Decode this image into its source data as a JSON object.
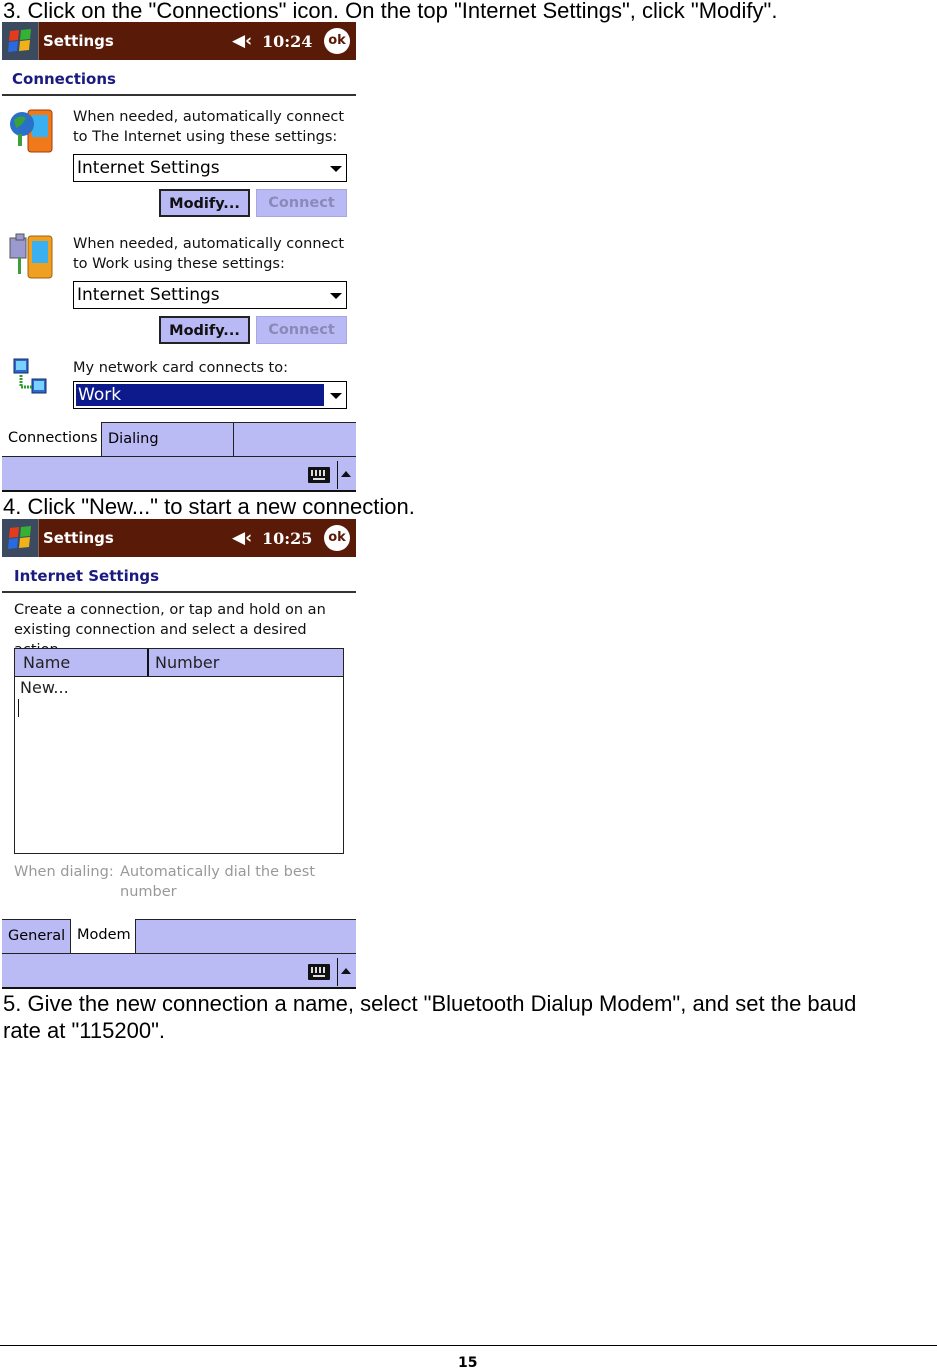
{
  "steps": {
    "step3": "3. Click on the \"Connections\" icon. On the top \"Internet Settings\", click \"Modify\".",
    "step4": "4. Click \"New...\" to start a new connection.",
    "step5_line1": "5. Give the new connection a name, select \"Bluetooth Dialup Modem\", and set the baud",
    "step5_line2": "rate at \"115200\"."
  },
  "colors": {
    "titlebar": "#5a1a08",
    "header_text": "#1a1a80",
    "tab_bg": "#babaf4",
    "selection": "#0c1a8c"
  },
  "screen1": {
    "titlebar": {
      "icon": "windows-start-icon",
      "title": "Settings",
      "volume_icon": "speaker-icon",
      "time": "10:24",
      "ok_label": "ok"
    },
    "header": "Connections",
    "internet": {
      "icon": "globe-pda-icon",
      "desc_line1": "When needed, automatically connect",
      "desc_line2": "to The Internet using these settings:",
      "dropdown_value": "Internet Settings",
      "modify_label": "Modify...",
      "connect_label": "Connect"
    },
    "work": {
      "icon": "building-pda-icon",
      "desc_line1": "When needed, automatically connect",
      "desc_line2": "to Work using these settings:",
      "dropdown_value": "Internet Settings",
      "modify_label": "Modify...",
      "connect_label": "Connect"
    },
    "network": {
      "icon": "network-computers-icon",
      "label": "My network card connects to:",
      "dropdown_value": "Work"
    },
    "tabs": [
      {
        "label": "Connections",
        "active": true
      },
      {
        "label": "Dialing Locations",
        "active": false
      }
    ],
    "menubar": {
      "keyboard_icon": "keyboard-icon",
      "arrow_icon": "up-arrow-icon"
    }
  },
  "screen2": {
    "titlebar": {
      "icon": "windows-start-icon",
      "title": "Settings",
      "volume_icon": "speaker-icon",
      "time": "10:25",
      "ok_label": "ok"
    },
    "header": "Internet Settings",
    "desc_line1": "Create a connection, or tap and hold on an",
    "desc_line2": "existing connection and select a desired action.",
    "list": {
      "columns": [
        "Name",
        "Number"
      ],
      "items": [
        "New..."
      ]
    },
    "when_dialing_label": "When dialing:",
    "when_dialing_value_line1": "Automatically dial the best",
    "when_dialing_value_line2": "number",
    "tabs": [
      {
        "label": "General",
        "active": false
      },
      {
        "label": "Modem",
        "active": true
      }
    ],
    "menubar": {
      "keyboard_icon": "keyboard-icon",
      "arrow_icon": "up-arrow-icon"
    }
  },
  "footer": {
    "page_number": "15"
  }
}
